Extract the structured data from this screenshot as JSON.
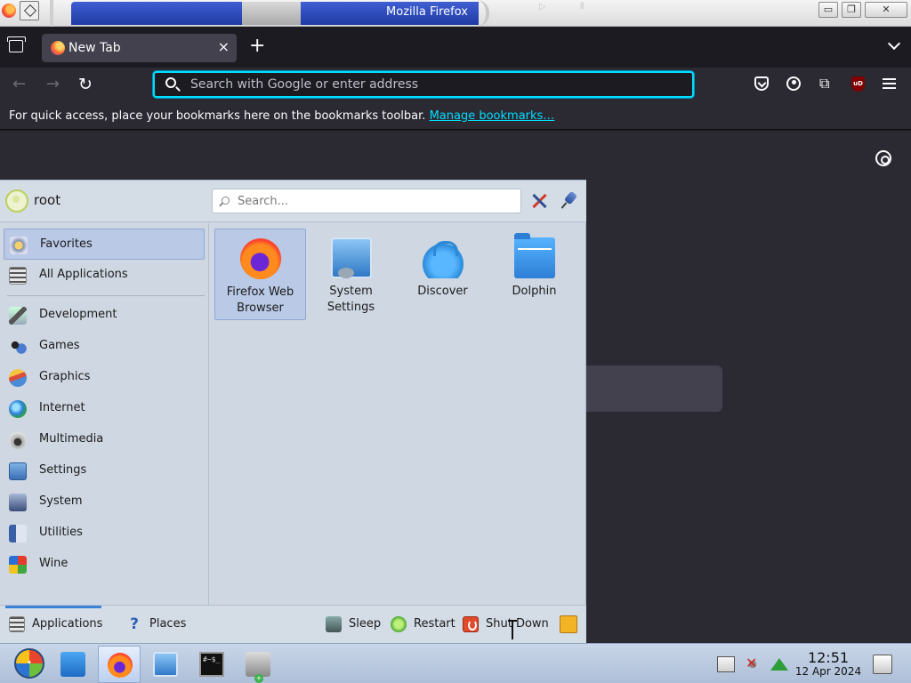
{
  "window": {
    "title": "Mozilla Firefox",
    "controls": {
      "minimize": "▭",
      "maximize": "❐",
      "close": "✕"
    }
  },
  "browser": {
    "tab": {
      "title": "New Tab",
      "close": "×"
    },
    "new_tab": "+",
    "nav": {
      "back": "←",
      "forward": "→",
      "reload": "↻"
    },
    "urlbar": {
      "placeholder": "Search with Google or enter address",
      "value": ""
    },
    "toolbar_icons": [
      "pocket-icon",
      "account-icon",
      "extensions-icon",
      "ublock-icon",
      "menu-icon"
    ],
    "ublock_badge": "uD",
    "extensions_glyph": "⧉",
    "bookmarks": {
      "message": "For quick access, place your bookmarks here on the bookmarks toolbar.",
      "link": "Manage bookmarks…"
    },
    "colors": {
      "accent": "#00ddff",
      "background": "#2b2a33",
      "tabstrip": "#1c1b22"
    }
  },
  "kickoff": {
    "user": "root",
    "search": {
      "placeholder": "Search...",
      "value": ""
    },
    "categories": [
      {
        "label": "Favorites",
        "icon": "favorites-icon",
        "selected": true
      },
      {
        "label": "All Applications",
        "icon": "all-applications-icon"
      },
      {
        "label": "Development",
        "icon": "development-icon"
      },
      {
        "label": "Games",
        "icon": "games-icon"
      },
      {
        "label": "Graphics",
        "icon": "graphics-icon"
      },
      {
        "label": "Internet",
        "icon": "internet-icon"
      },
      {
        "label": "Multimedia",
        "icon": "multimedia-icon"
      },
      {
        "label": "Settings",
        "icon": "settings-icon"
      },
      {
        "label": "System",
        "icon": "system-icon"
      },
      {
        "label": "Utilities",
        "icon": "utilities-icon"
      },
      {
        "label": "Wine",
        "icon": "wine-icon"
      }
    ],
    "favorites": [
      {
        "label": "Firefox Web Browser",
        "icon": "firefox-icon",
        "selected": true
      },
      {
        "label": "System Settings",
        "icon": "system-settings-icon"
      },
      {
        "label": "Discover",
        "icon": "discover-icon"
      },
      {
        "label": "Dolphin",
        "icon": "dolphin-icon"
      }
    ],
    "footer": {
      "applications": "Applications",
      "places": "Places",
      "places_glyph": "?",
      "sleep": "Sleep",
      "restart": "Restart",
      "shutdown": "Shut Down"
    },
    "colors": {
      "panel": "#ced7e2",
      "selection": "#b9c9e6",
      "indicator": "#3a82d8"
    }
  },
  "taskbar": {
    "tasks": [
      "file-manager-icon",
      "firefox-icon",
      "system-settings-icon",
      "terminal-icon",
      "application-launcher-icon"
    ],
    "terminal_text": "#~$_",
    "badge": "+",
    "tray_icons": [
      "clipboard-icon",
      "audio-muted-icon",
      "network-icon",
      "show-desktop-icon"
    ],
    "clock": {
      "time": "12:51",
      "date": "12 Apr 2024"
    }
  }
}
